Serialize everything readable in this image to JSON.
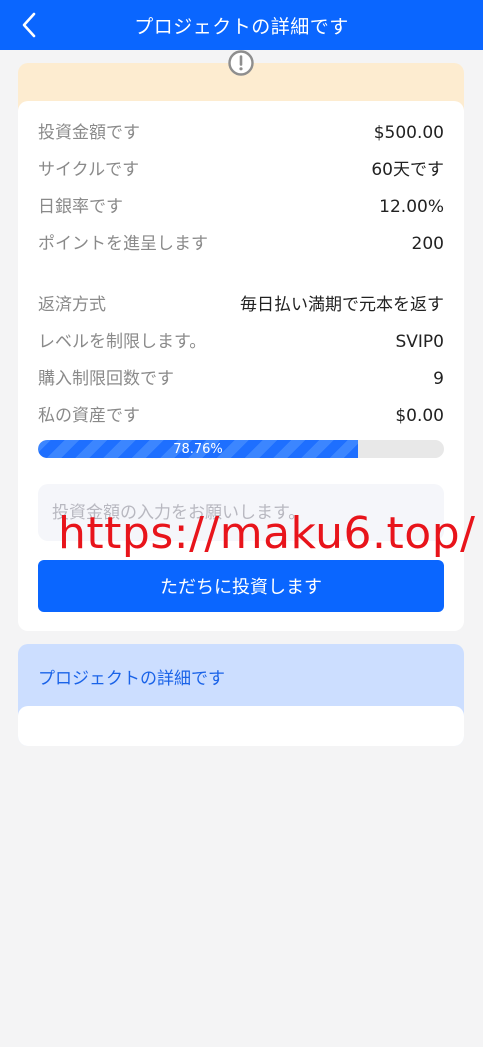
{
  "header": {
    "title": "プロジェクトの詳細です"
  },
  "details": [
    {
      "label": "投資金額です",
      "value": "$500.00"
    },
    {
      "label": "サイクルです",
      "value": "60天です"
    },
    {
      "label": "日銀率です",
      "value": "12.00%"
    },
    {
      "label": "ポイントを進呈します",
      "value": "200"
    },
    {
      "label": "返済方式",
      "value": "毎日払い満期で元本を返す"
    },
    {
      "label": "レベルを制限します。",
      "value": "SVIP0"
    },
    {
      "label": "購入制限回数です",
      "value": "9"
    },
    {
      "label": "私の資産です",
      "value": "$0.00"
    }
  ],
  "progress": {
    "percent": 78.76,
    "label": "78.76%"
  },
  "input": {
    "placeholder": "投資金額の入力をお願いします。"
  },
  "invest_button": {
    "label": "ただちに投資します"
  },
  "watermark": "https://maku6.top/",
  "detail_section": {
    "title": "プロジェクトの詳細です"
  },
  "colors": {
    "primary": "#0a66ff",
    "notice_bg": "#fdecd0",
    "detail_bg": "#ccdeff",
    "watermark": "#e8141b"
  },
  "icons": {
    "back": "chevron-left-icon",
    "info": "exclamation-circle-icon"
  }
}
